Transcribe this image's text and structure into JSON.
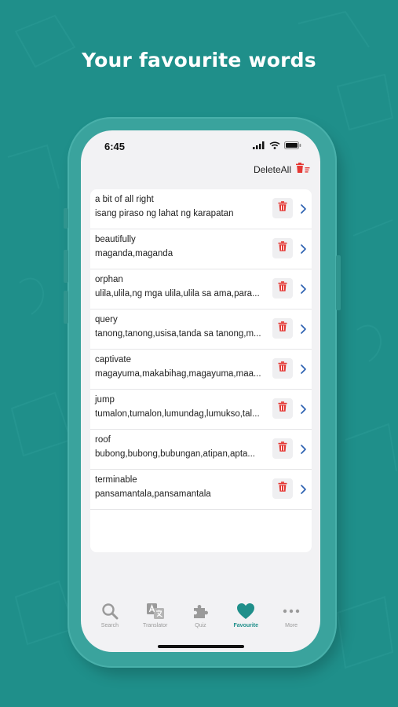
{
  "headline": "Your favourite words",
  "status": {
    "time": "6:45"
  },
  "toolbar": {
    "delete_all_label": "DeleteAll"
  },
  "favourites": [
    {
      "word": "a bit of all right",
      "translation": "isang piraso ng lahat ng karapatan"
    },
    {
      "word": "beautifully",
      "translation": "maganda,maganda"
    },
    {
      "word": "orphan",
      "translation": "ulila,ulila,ng mga ulila,ulila sa ama,para..."
    },
    {
      "word": "query",
      "translation": "tanong,tanong,usisa,tanda sa tanong,m..."
    },
    {
      "word": "captivate",
      "translation": "magayuma,makabihag,magayuma,maa..."
    },
    {
      "word": "jump",
      "translation": "tumalon,tumalon,lumundag,lumukso,tal..."
    },
    {
      "word": "roof",
      "translation": "bubong,bubong,bubungan,atipan,apta..."
    },
    {
      "word": "terminable",
      "translation": "pansamantala,pansamantala"
    }
  ],
  "tabs": [
    {
      "label": "Search",
      "icon": "search-icon",
      "active": false
    },
    {
      "label": "Translator",
      "icon": "translator-icon",
      "active": false
    },
    {
      "label": "Quiz",
      "icon": "puzzle-icon",
      "active": false
    },
    {
      "label": "Favourite",
      "icon": "heart-icon",
      "active": true
    },
    {
      "label": "More",
      "icon": "more-icon",
      "active": false
    }
  ],
  "colors": {
    "background": "#1f8f8a",
    "accent": "#1f8f8a",
    "delete_red": "#e53935",
    "chevron_blue": "#2a5fb0"
  }
}
